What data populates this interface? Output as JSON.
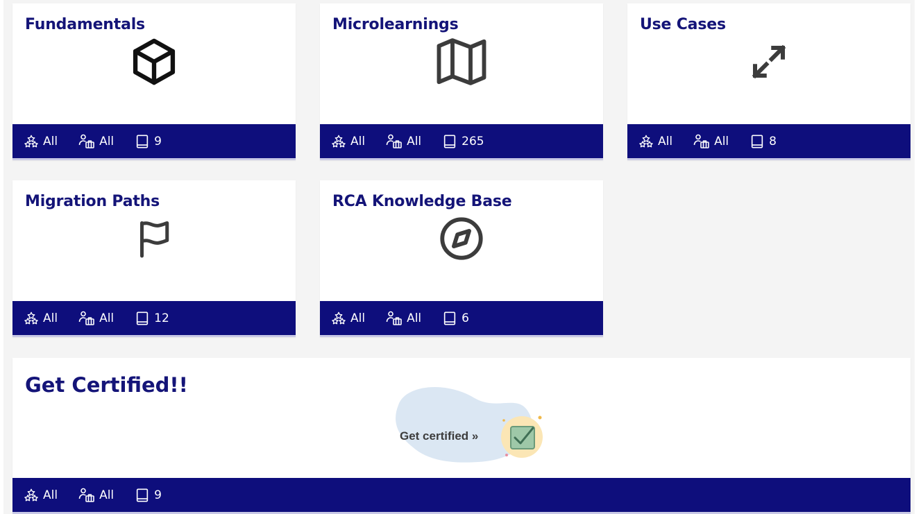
{
  "cards": [
    {
      "title": "Fundamentals",
      "icon": "cube-icon",
      "levels": "All",
      "roles": "All",
      "count": "9"
    },
    {
      "title": "Microlearnings",
      "icon": "map-icon",
      "levels": "All",
      "roles": "All",
      "count": "265"
    },
    {
      "title": "Use Cases",
      "icon": "expand-arrows-icon",
      "levels": "All",
      "roles": "All",
      "count": "8"
    },
    {
      "title": "Migration Paths",
      "icon": "flag-icon",
      "levels": "All",
      "roles": "All",
      "count": "12"
    },
    {
      "title": "RCA Knowledge Base",
      "icon": "compass-icon",
      "levels": "All",
      "roles": "All",
      "count": "6"
    }
  ],
  "certified": {
    "title": "Get Certified!!",
    "badge_text": "Get certified »",
    "icon": "certificate-check-icon",
    "levels": "All",
    "roles": "All",
    "count": "9"
  },
  "colors": {
    "title": "#141478",
    "footer_bg": "#0e0e7c",
    "page_bg": "#f4f4f4"
  }
}
